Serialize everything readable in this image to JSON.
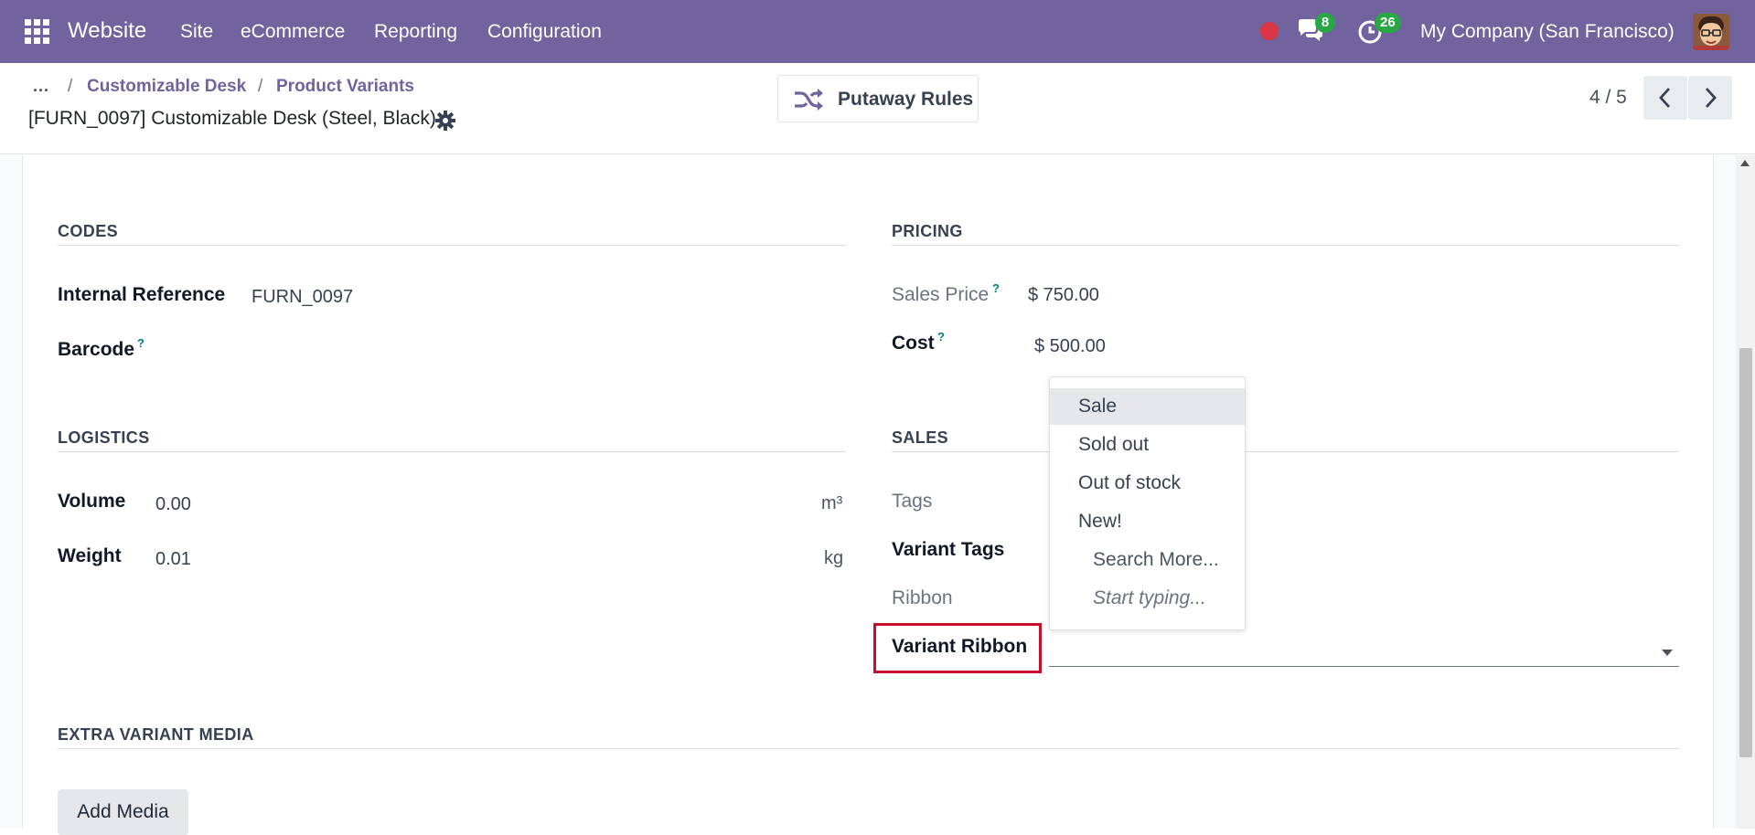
{
  "navbar": {
    "brand": "Website",
    "menu": [
      "Site",
      "eCommerce",
      "Reporting",
      "Configuration"
    ],
    "messages_count": "8",
    "activities_count": "26",
    "company": "My Company (San Francisco)",
    "icons": {
      "apps": "apps-grid-icon",
      "recording": "record-dot-icon",
      "messages": "chat-icon",
      "activities": "clock-icon"
    },
    "colors": {
      "bar": "#71639e",
      "badge": "#28a745",
      "recording": "#dc3545"
    }
  },
  "breadcrumb": {
    "dots": "...",
    "separator": "/",
    "items": [
      "Customizable Desk",
      "Product Variants"
    ]
  },
  "record": {
    "title": "[FURN_0097] Customizable Desk (Steel, Black)"
  },
  "smart_button": {
    "label": "Putaway Rules",
    "icon": "shuffle-icon"
  },
  "pager": {
    "value": "4 / 5"
  },
  "codes": {
    "title": "CODES",
    "internal_reference_label": "Internal Reference",
    "internal_reference_value": "FURN_0097",
    "barcode_label": "Barcode",
    "help": "?"
  },
  "pricing": {
    "title": "PRICING",
    "sales_price_label": "Sales Price",
    "sales_price_value": "$ 750.00",
    "cost_label": "Cost",
    "cost_value": "$ 500.00",
    "help": "?"
  },
  "logistics": {
    "title": "LOGISTICS",
    "volume_label": "Volume",
    "volume_value": "0.00",
    "volume_unit": "m³",
    "weight_label": "Weight",
    "weight_value": "0.01",
    "weight_unit": "kg"
  },
  "sales": {
    "title": "SALES",
    "tags_label": "Tags",
    "variant_tags_label": "Variant Tags",
    "ribbon_label": "Ribbon",
    "variant_ribbon_label": "Variant Ribbon"
  },
  "dropdown": {
    "items": [
      "Sale",
      "Sold out",
      "Out of stock",
      "New!"
    ],
    "search_more": "Search More...",
    "start_typing": "Start typing..."
  },
  "media": {
    "title": "EXTRA VARIANT MEDIA",
    "add_button": "Add Media"
  }
}
